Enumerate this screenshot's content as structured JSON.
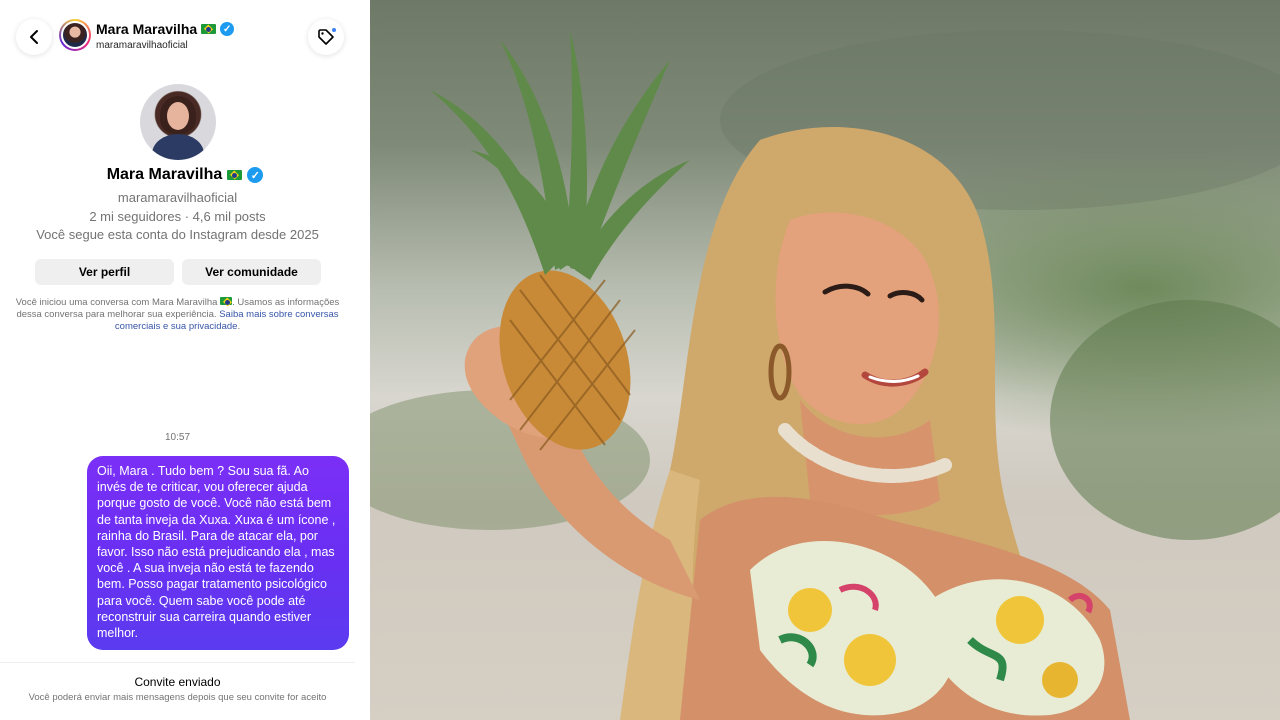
{
  "header": {
    "name": "Mara Maravilha",
    "handle": "maramaravilhaoficial",
    "verified_mark": "✓"
  },
  "profile": {
    "name": "Mara Maravilha",
    "handle": "maramaravilhaoficial",
    "stats": "2 mi seguidores · 4,6 mil posts",
    "follow_info": "Você segue esta conta do Instagram desde 2025",
    "view_profile_label": "Ver perfil",
    "view_community_label": "Ver comunidade"
  },
  "notice": {
    "text_a": "Você iniciou uma conversa com Mara Maravilha",
    "text_b": ". Usamos as informações dessa conversa para melhorar sua experiência.",
    "link": "Saiba mais sobre conversas comerciais e sua privacidade",
    "end": "."
  },
  "chat": {
    "timestamp": "10:57",
    "message": "Oii, Mara . Tudo bem ? Sou sua fã. Ao invés de te criticar, vou oferecer ajuda porque gosto de você. Você não está bem de tanta inveja da Xuxa. Xuxa é um ícone , rainha do Brasil. Para de atacar ela, por favor. Isso não está prejudicando ela , mas você . A sua inveja não está te fazendo bem. Posso pagar tratamento psicológico para você. Quem sabe você pode até reconstruir sua carreira quando estiver melhor."
  },
  "footer": {
    "title": "Convite enviado",
    "subtitle": "Você poderá enviar mais mensagens depois que seu convite for aceito"
  },
  "colors": {
    "bubble_gradient_top": "#7b2ff7",
    "bubble_gradient_bottom": "#5b3bef",
    "verified_blue": "#1d9bf0",
    "link_blue": "#3856a8"
  },
  "icons": {
    "back": "back-chevron-icon",
    "tag": "tag-icon",
    "verified": "verified-badge-icon",
    "flag": "brazil-flag-icon"
  }
}
